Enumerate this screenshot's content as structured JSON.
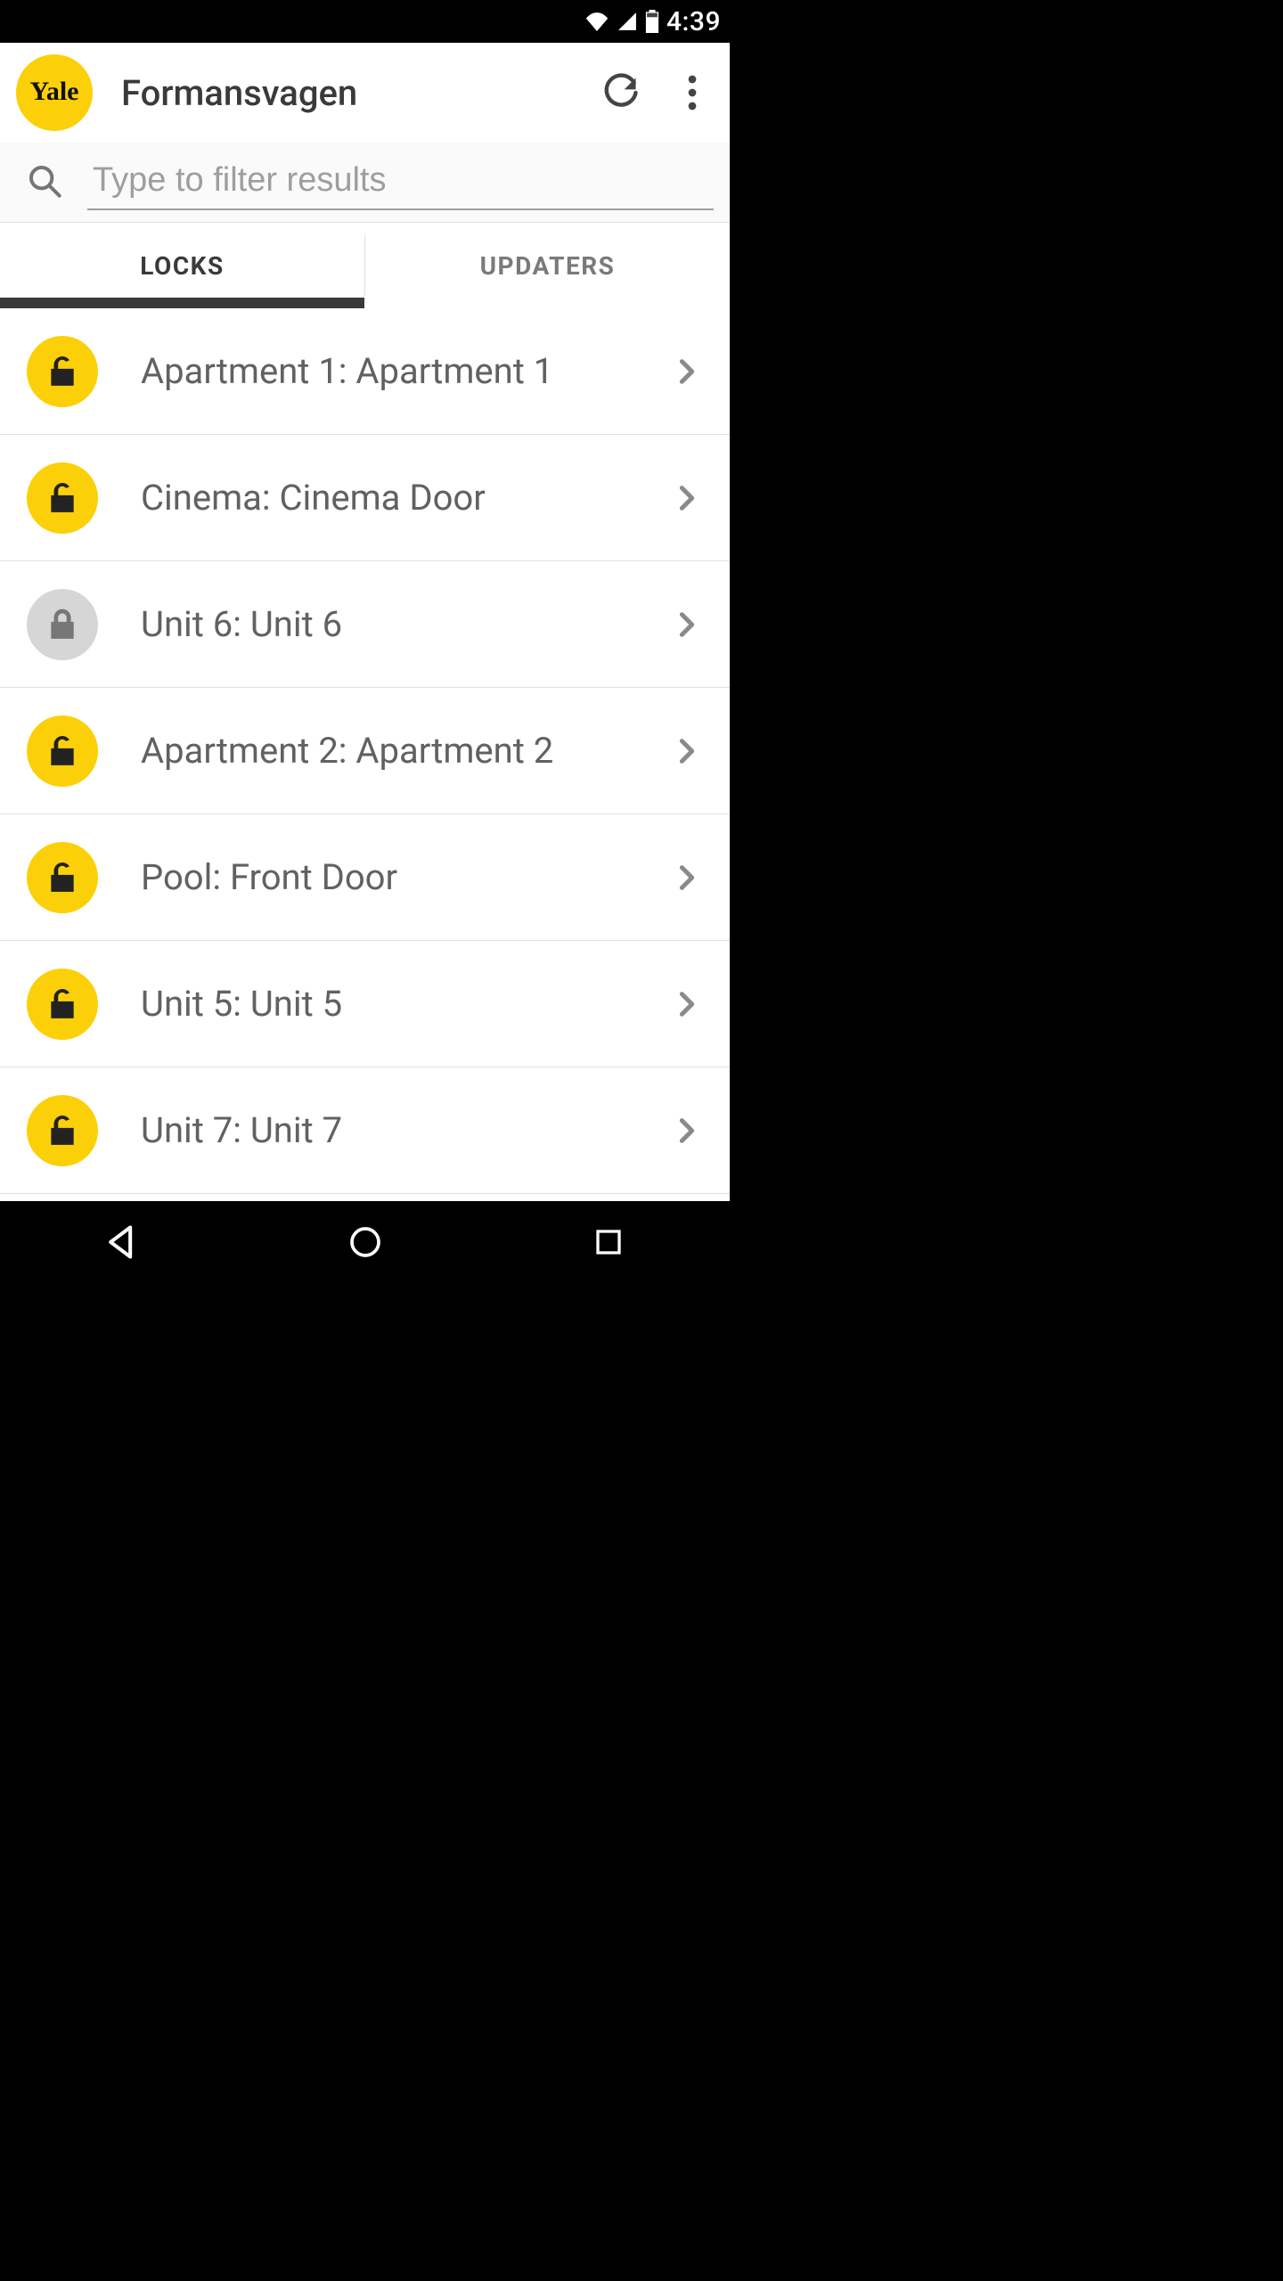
{
  "statusbar": {
    "time": "4:39"
  },
  "appbar": {
    "logo_text": "Yale",
    "title": "Formansvagen"
  },
  "search": {
    "placeholder": "Type to filter results",
    "value": ""
  },
  "tabs": {
    "locks": "LOCKS",
    "updaters": "UPDATERS",
    "active": "locks"
  },
  "locks": [
    {
      "label": "Apartment 1: Apartment 1",
      "state": "open"
    },
    {
      "label": "Cinema: Cinema Door",
      "state": "open"
    },
    {
      "label": "Unit 6: Unit 6",
      "state": "locked"
    },
    {
      "label": "Apartment 2: Apartment 2",
      "state": "open"
    },
    {
      "label": "Pool: Front Door",
      "state": "open"
    },
    {
      "label": "Unit 5: Unit 5",
      "state": "open"
    },
    {
      "label": "Unit 7: Unit 7",
      "state": "open"
    }
  ],
  "colors": {
    "brand_yellow": "#fcd008",
    "text_muted": "#616161"
  }
}
